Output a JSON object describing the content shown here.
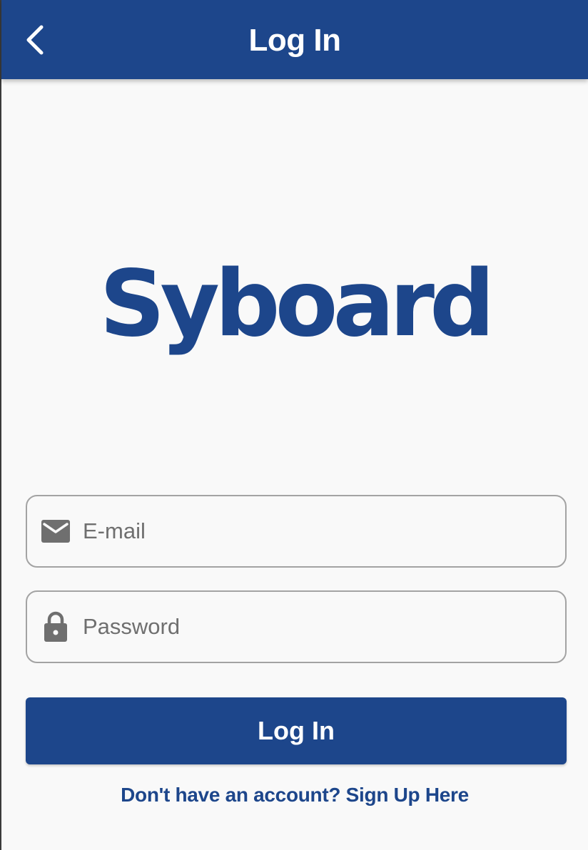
{
  "app_bar": {
    "title": "Log In",
    "back_icon": "chevron-left-icon",
    "background_color": "#1d468b"
  },
  "logo": {
    "text": "Syboard",
    "color": "#1d468b"
  },
  "form": {
    "email": {
      "placeholder": "E-mail",
      "value": "",
      "icon": "mail-icon"
    },
    "password": {
      "placeholder": "Password",
      "value": "",
      "icon": "lock-icon"
    },
    "submit_label": "Log In"
  },
  "signup_link": "Don't have an account? Sign Up Here"
}
